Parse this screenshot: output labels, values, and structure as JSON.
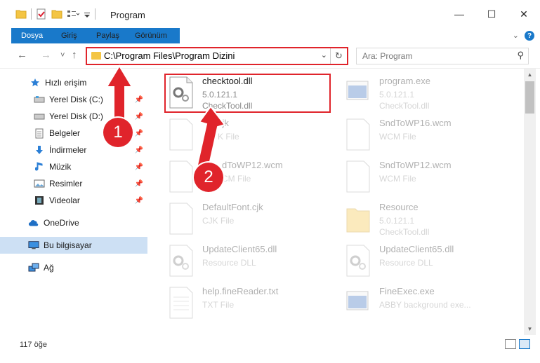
{
  "window": {
    "title": "Program",
    "min_glyph": "—",
    "max_glyph": "☐",
    "close_glyph": "✕"
  },
  "ribbon": {
    "tabs": [
      "Dosya",
      "Giriş",
      "Paylaş",
      "Görünüm"
    ],
    "expand_glyph": "⌄",
    "help_glyph": "?"
  },
  "address": {
    "path": "C:\\Program Files\\Program Dizini",
    "refresh_glyph": "↻",
    "chevron_glyph": "⌄"
  },
  "search": {
    "placeholder": "Ara: Program",
    "icon": "search-icon",
    "glyph": "⚲"
  },
  "nav": {
    "back_glyph": "←",
    "forward_glyph": "→",
    "recent_glyph": "˅",
    "up_glyph": "↑"
  },
  "sidebar": {
    "items": [
      {
        "label": "Hızlı erişim",
        "icon": "star-icon"
      },
      {
        "label": "Yerel Disk (C:)",
        "icon": "drive-icon",
        "pinned": true
      },
      {
        "label": "Yerel Disk (D:)",
        "icon": "drive-icon",
        "pinned": true
      },
      {
        "label": "Belgeler",
        "icon": "documents-icon",
        "pinned": true
      },
      {
        "label": "İndirmeler",
        "icon": "download-icon",
        "pinned": true
      },
      {
        "label": "Müzik",
        "icon": "music-icon",
        "pinned": true
      },
      {
        "label": "Resimler",
        "icon": "pictures-icon",
        "pinned": true
      },
      {
        "label": "Videolar",
        "icon": "videos-icon",
        "pinned": true
      },
      {
        "label": "OneDrive",
        "icon": "cloud-icon"
      },
      {
        "label": "Bu bilgisayar",
        "icon": "computer-icon",
        "selected": true
      },
      {
        "label": "Ağ",
        "icon": "network-icon"
      }
    ]
  },
  "files": {
    "left": [
      {
        "name": "checktool.dll",
        "line2": "5.0.121.1",
        "line3": "CheckTool.dll",
        "icon": "dll-gear-icon",
        "highlighted": true
      },
      {
        "name": "cjk",
        "line2": "K File",
        "line3": "",
        "icon": "blank-file-icon",
        "faded": true
      },
      {
        "name": "dToWP12.wcm",
        "line2": "CM File",
        "line3": "",
        "icon": "blank-file-icon",
        "faded": true
      },
      {
        "name": "DefaultFont.cjk",
        "line2": "CJK File",
        "line3": "",
        "icon": "blank-file-icon",
        "faded": true
      },
      {
        "name": "UpdateClient65.dll",
        "line2": "Resource DLL",
        "line3": "",
        "icon": "dll-gear-icon",
        "faded": true
      },
      {
        "name": "help.fineReader.txt",
        "line2": "TXT File",
        "line3": "",
        "icon": "text-file-icon",
        "faded": true
      }
    ],
    "right": [
      {
        "name": "program.exe",
        "line2": "5.0.121.1",
        "line3": "CheckTool.dll",
        "icon": "exe-icon",
        "faded": true
      },
      {
        "name": "SndToWP16.wcm",
        "line2": "WCM File",
        "line3": "",
        "icon": "blank-file-icon",
        "faded": true
      },
      {
        "name": "SndToWP12.wcm",
        "line2": "WCM File",
        "line3": "",
        "icon": "blank-file-icon",
        "faded": true
      },
      {
        "name": "Resource",
        "line2": "5.0.121.1",
        "line3": "CheckTool.dll",
        "icon": "folder-icon",
        "faded": true
      },
      {
        "name": "UpdateClient65.dll",
        "line2": "Resource DLL",
        "line3": "",
        "icon": "dll-gear-icon",
        "faded": true
      },
      {
        "name": "FineExec.exe",
        "line2": "ABBY background exe...",
        "line3": "",
        "icon": "exe-icon",
        "faded": true
      }
    ]
  },
  "status": {
    "count": "117 öğe"
  },
  "annotations": {
    "badge1": "1",
    "badge2": "2",
    "color": "#e0242b"
  },
  "colors": {
    "accent": "#1979ca",
    "selection": "#cde0f4",
    "folder": "#f4c544"
  }
}
